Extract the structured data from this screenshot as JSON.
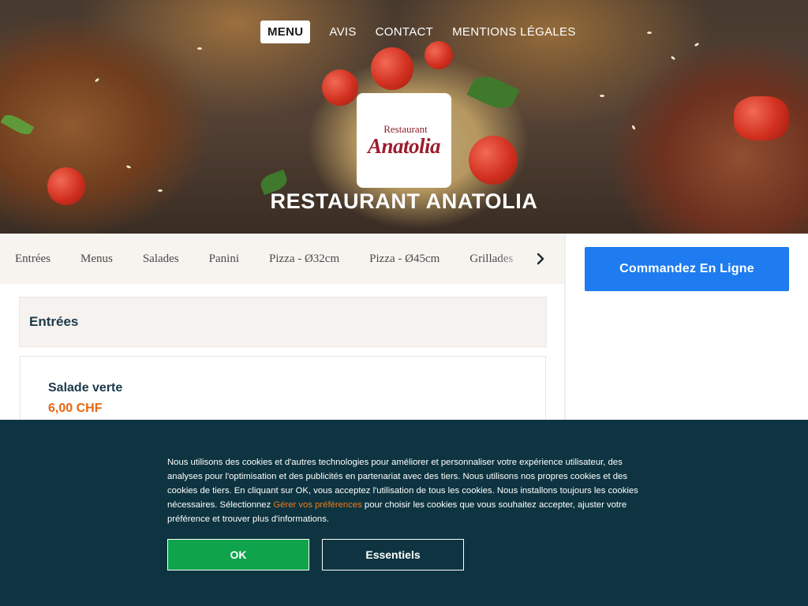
{
  "nav": {
    "items": [
      {
        "label": "MENU",
        "active": true
      },
      {
        "label": "AVIS",
        "active": false
      },
      {
        "label": "CONTACT",
        "active": false
      },
      {
        "label": "MENTIONS LÉGALES",
        "active": false
      }
    ]
  },
  "hero": {
    "logo_small": "Restaurant",
    "logo_big": "Anatolia",
    "title": "RESTAURANT ANATOLIA"
  },
  "categories": {
    "items": [
      "Entrées",
      "Menus",
      "Salades",
      "Panini",
      "Pizza - Ø32cm",
      "Pizza - Ø45cm",
      "Grillades"
    ],
    "next_icon": "chevron-right-icon"
  },
  "menu": {
    "section_title": "Entrées",
    "dishes": [
      {
        "name": "Salade verte",
        "price": "6,00 CHF"
      }
    ]
  },
  "sidebar": {
    "order_label": "Commandez En Ligne"
  },
  "cookie": {
    "text_before": "Nous utilisons des cookies et d'autres technologies pour améliorer et personnaliser votre expérience utilisateur, des analyses pour l'optimisation et des publicités en partenariat avec des tiers. Nous utilisons nos propres cookies et des cookies de tiers. En cliquant sur OK, vous acceptez l'utilisation de tous les cookies. Nous installons toujours les cookies nécessaires. Sélectionnez ",
    "link_text": "Gérer vos préférences",
    "text_after": " pour choisir les cookies que vous souhaitez accepter, ajuster votre préférence et trouver plus d'informations.",
    "ok_label": "OK",
    "essentials_label": "Essentiels"
  },
  "colors": {
    "order_button": "#1e7cf0",
    "price": "#e8650f",
    "cookie_bg": "#0d3440",
    "ok_button": "#0fa34c",
    "link": "#f07c1c",
    "logo_red": "#9b1c2c"
  }
}
